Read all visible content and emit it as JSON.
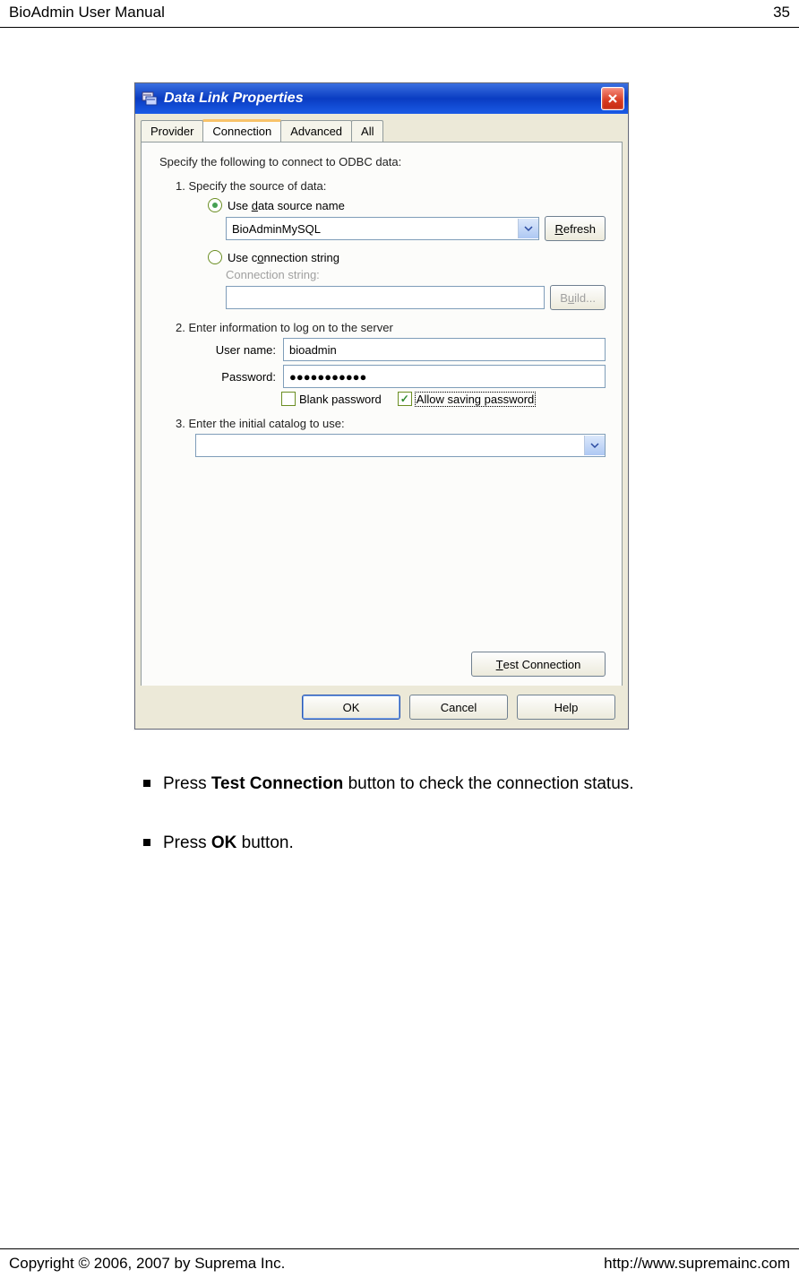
{
  "header": {
    "title": "BioAdmin  User  Manual",
    "page": "35"
  },
  "footer": {
    "copyright": "Copyright © 2006, 2007 by Suprema Inc.",
    "url": "http://www.supremainc.com"
  },
  "dialog": {
    "title": "Data Link Properties",
    "tabs": {
      "provider": "Provider",
      "connection": "Connection",
      "advanced": "Advanced",
      "all": "All"
    },
    "intro": "Specify the following to connect to ODBC data:",
    "s1": {
      "label": "1. Specify the source of data:",
      "opt_dsn_pre": "Use ",
      "opt_dsn_u": "d",
      "opt_dsn_post": "ata source name",
      "dsn_value": "BioAdminMySQL",
      "refresh_u": "R",
      "refresh_post": "efresh",
      "opt_cs_pre": "Use c",
      "opt_cs_u": "o",
      "opt_cs_post": "nnection string",
      "cs_label_u": "C",
      "cs_label_post": "onnection string:",
      "build_pre": "B",
      "build_u": "u",
      "build_post": "ild..."
    },
    "s2": {
      "label": "2. Enter information to log on to the server",
      "user_pre": "User ",
      "user_u": "n",
      "user_post": "ame:",
      "user_value": "bioadmin",
      "pass_u": "P",
      "pass_post": "assword:",
      "pass_value": "●●●●●●●●●●●",
      "blank_u": "B",
      "blank_post": "lank password",
      "allow": "Allow saving password"
    },
    "s3": {
      "label_pre": "3. Enter the ",
      "label_u": "i",
      "label_post": "nitial catalog to use:"
    },
    "test_u": "T",
    "test_post": "est Connection",
    "buttons": {
      "ok": "OK",
      "cancel": "Cancel",
      "help": "Help"
    }
  },
  "instructions": {
    "line1_pre": "Press ",
    "line1_bold": "Test Connection",
    "line1_post": " button to check the connection status.",
    "line2_pre": "Press ",
    "line2_bold": "OK",
    "line2_post": " button."
  }
}
